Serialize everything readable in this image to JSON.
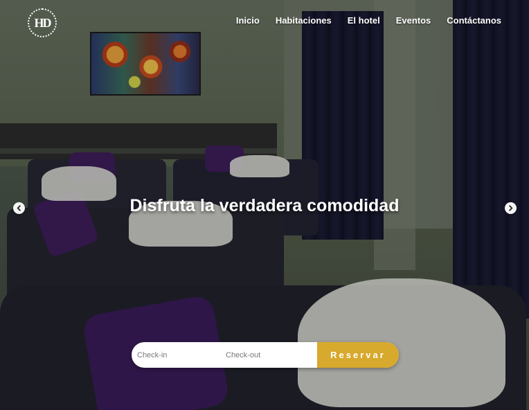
{
  "brand": {
    "logo_text": "HD"
  },
  "nav": {
    "items": [
      {
        "label": "Inicio"
      },
      {
        "label": "Habitaciones"
      },
      {
        "label": "El hotel"
      },
      {
        "label": "Eventos"
      },
      {
        "label": "Contáctanos"
      }
    ]
  },
  "hero": {
    "headline": "Disfruta la verdadera comodidad",
    "prev_icon": "chevron-left-circle-icon",
    "next_icon": "chevron-right-circle-icon"
  },
  "booking": {
    "checkin_placeholder": "Check-in",
    "checkout_placeholder": "Check-out",
    "submit_label": "Reservar"
  },
  "colors": {
    "accent": "#d7a92c",
    "text_light": "#ffffff"
  }
}
